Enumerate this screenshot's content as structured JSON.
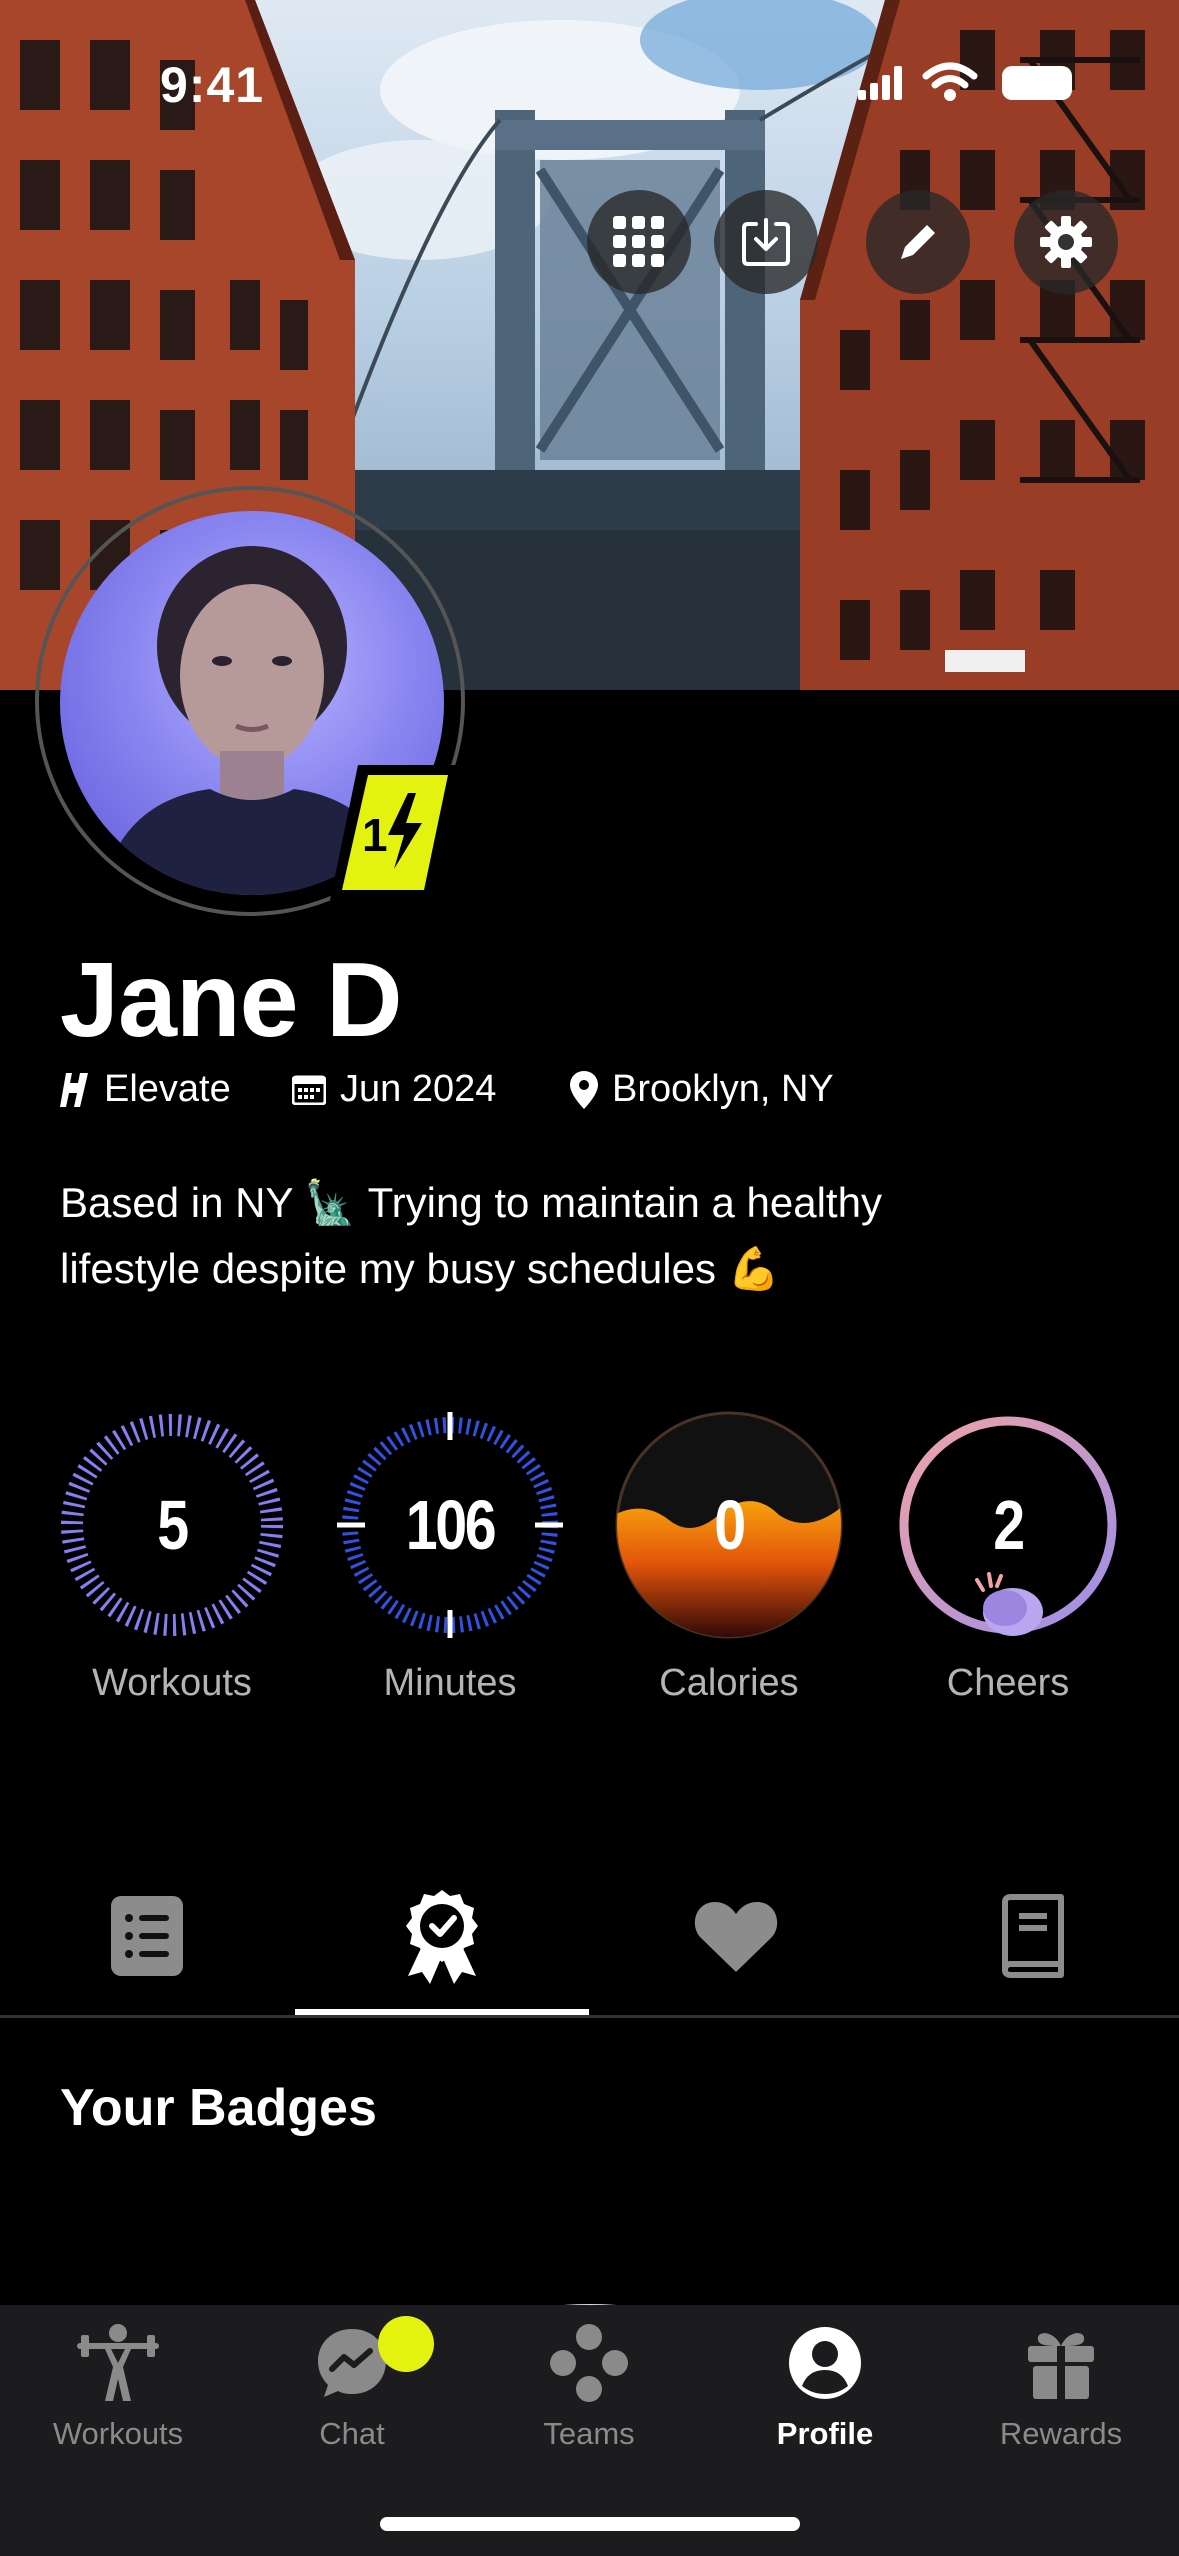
{
  "status_bar": {
    "time": "9:41"
  },
  "header_actions": [
    {
      "name": "qr-code-button",
      "icon": "qr-grid-icon"
    },
    {
      "name": "download-button",
      "icon": "download-tray-icon"
    },
    {
      "name": "edit-profile-button",
      "icon": "pencil-icon"
    },
    {
      "name": "settings-button",
      "icon": "gear-icon"
    }
  ],
  "profile": {
    "name": "Jane D",
    "level": "1",
    "team": "Elevate",
    "joined": "Jun 2024",
    "location": "Brooklyn, NY",
    "bio_line1": "Based in NY 🗽 Trying to maintain a healthy",
    "bio_line2": "lifestyle despite my busy schedules 💪"
  },
  "stats": [
    {
      "value": "5",
      "label": "Workouts"
    },
    {
      "value": "106",
      "label": "Minutes"
    },
    {
      "value": "0",
      "label": "Calories"
    },
    {
      "value": "2",
      "label": "Cheers"
    }
  ],
  "tabs": [
    {
      "name": "tab-list",
      "icon": "list-icon"
    },
    {
      "name": "tab-badges",
      "icon": "award-badge-icon",
      "active": true
    },
    {
      "name": "tab-favorites",
      "icon": "heart-icon"
    },
    {
      "name": "tab-journal",
      "icon": "book-icon"
    }
  ],
  "section": {
    "title": "Your Badges"
  },
  "bottom_nav": [
    {
      "label": "Workouts",
      "icon": "weightlifter-icon"
    },
    {
      "label": "Chat",
      "icon": "chat-bubble-icon",
      "has_notification": true
    },
    {
      "label": "Teams",
      "icon": "teams-dots-icon"
    },
    {
      "label": "Profile",
      "icon": "user-circle-icon",
      "active": true
    },
    {
      "label": "Rewards",
      "icon": "gift-icon"
    }
  ],
  "colors": {
    "accent": "#E4F20F",
    "workouts_ring": "#8A7CF2",
    "minutes_ring": "#2F53E0",
    "calories_fill": "#F08A0A",
    "cheers_ring": "#E9A2B8"
  }
}
